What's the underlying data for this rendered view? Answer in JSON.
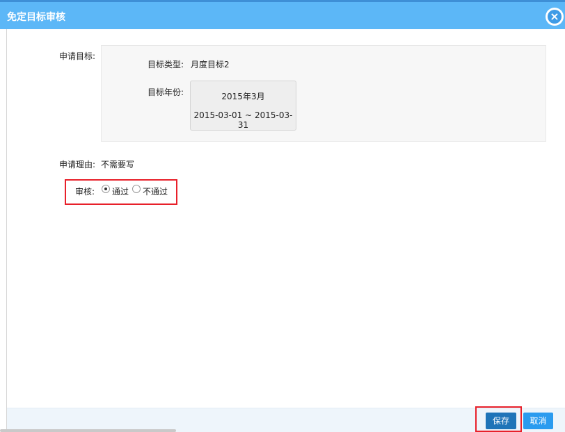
{
  "dialog": {
    "title": "免定目标审核",
    "close_icon": "close-circle-icon"
  },
  "form": {
    "apply_target_label": "申请目标:",
    "target_type_label": "目标类型:",
    "target_type_value": "月度目标2",
    "target_year_label": "目标年份:",
    "period_title": "2015年3月",
    "period_range": "2015-03-01 ~ 2015-03-31",
    "reason_label": "申请理由:",
    "reason_value": "不需要写",
    "review_label": "审核:",
    "review_options": [
      {
        "label": "通过",
        "checked": true
      },
      {
        "label": "不通过",
        "checked": false
      }
    ]
  },
  "footer": {
    "save_label": "保存",
    "cancel_label": "取消"
  },
  "colors": {
    "titlebar": "#5cb7f7",
    "highlight": "#e8202a",
    "save_button": "#1f74b8",
    "cancel_button": "#2a9bef"
  }
}
